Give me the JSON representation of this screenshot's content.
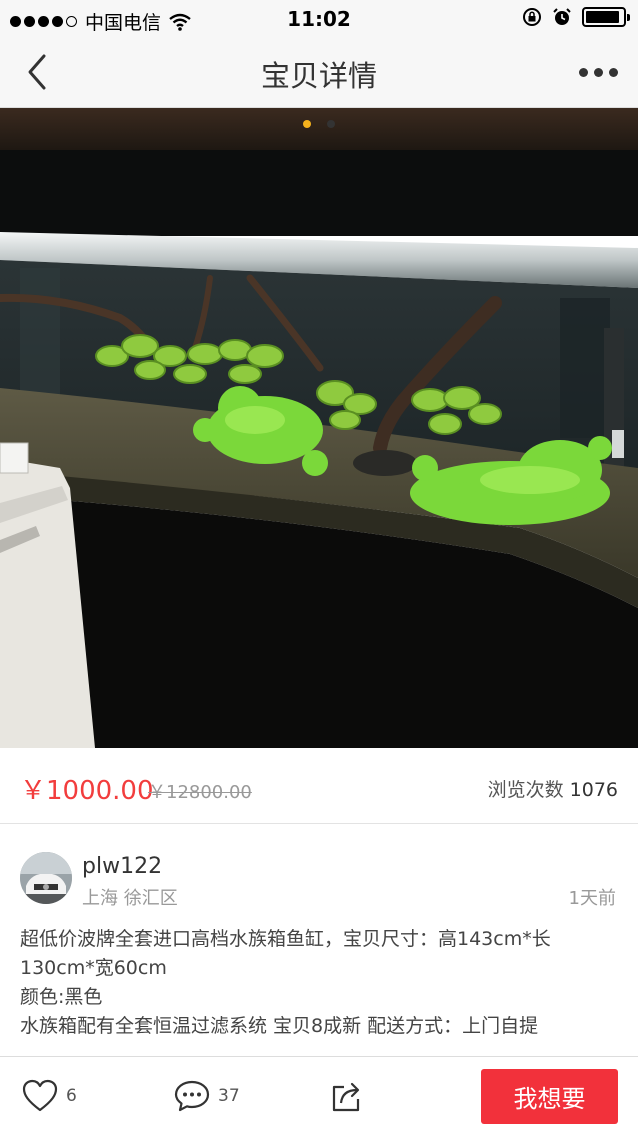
{
  "status_bar": {
    "carrier": "中国电信",
    "time": "11:02"
  },
  "nav": {
    "title": "宝贝详情"
  },
  "gallery": {
    "page_count": 2,
    "active_page": 1
  },
  "listing": {
    "price": "￥1000.00",
    "original_price": "￥12800.00",
    "views_label": "浏览次数",
    "views_count": "1076"
  },
  "seller": {
    "name": "plw122",
    "location": "上海 徐汇区",
    "posted": "1天前"
  },
  "description": {
    "line1": "超低价波牌全套进口高档水族箱鱼缸，宝贝尺寸：高143cm*长",
    "line2": "130cm*宽60cm",
    "line3": "颜色:黑色",
    "line4": "水族箱配有全套恒温过滤系统 宝贝8成新 配送方式：上门自提"
  },
  "actions": {
    "likes": "6",
    "comments": "37",
    "want_label": "我想要"
  },
  "colors": {
    "accent_red": "#f2313b",
    "price_red": "#f23d3d",
    "pager_active": "#f5b21d"
  }
}
